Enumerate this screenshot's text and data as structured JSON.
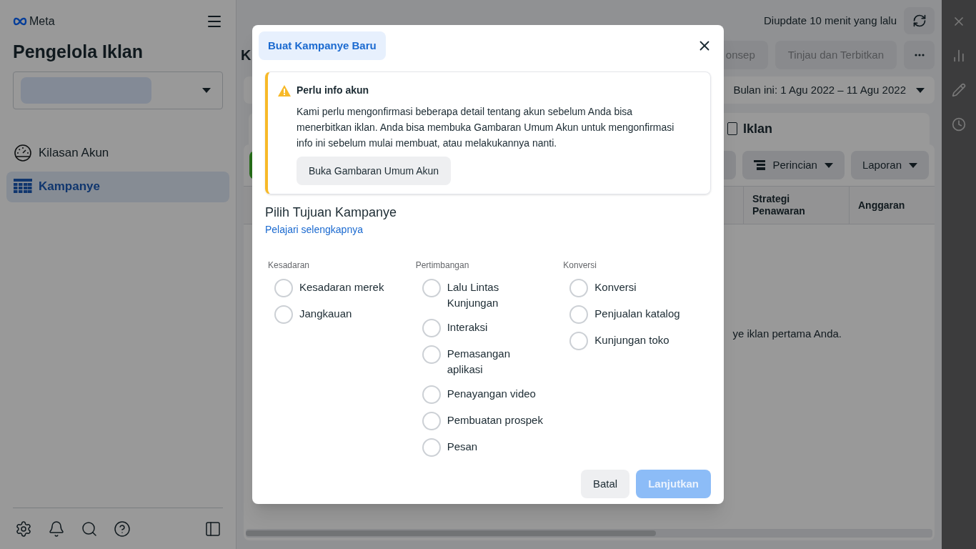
{
  "sidebar": {
    "logo": "Meta",
    "title": "Pengelola Iklan",
    "nav": [
      {
        "label": "Kilasan Akun",
        "kind": "overview",
        "selected": false
      },
      {
        "label": "Kampanye",
        "kind": "campaigns",
        "selected": true
      }
    ]
  },
  "main": {
    "updated": "Diupdate 10 menit yang lalu",
    "title_fragment": "K",
    "actions": [
      {
        "label": "onsep",
        "disabled": true
      },
      {
        "label": "Tinjau dan Terbitkan",
        "disabled": true
      }
    ],
    "date_range": "Bulan ini: 1 Agu 2022 – 11 Agu 2022",
    "tab": "Iklan",
    "toolbar": [
      {
        "label": "Perincian",
        "kind": "breakdown"
      },
      {
        "label": "Laporan",
        "kind": "plain"
      }
    ],
    "columns": [
      "Strategi Penawaran",
      "Anggaran"
    ],
    "empty_fragment": "ye iklan pertama Anda."
  },
  "modal": {
    "tab": {
      "label": "Buat Kampanye Baru",
      "selected": true
    },
    "notice": {
      "title": "Perlu info akun",
      "body": "Kami perlu mengonfirmasi beberapa detail tentang akun sebelum Anda bisa menerbitkan iklan. Anda bisa membuka Gambaran Umum Akun untuk mengonfirmasi info ini sebelum mulai membuat, atau melakukannya nanti.",
      "button": "Buka Gambaran Umum Akun"
    },
    "heading": "Pilih Tujuan Kampanye",
    "link": "Pelajari selengkapnya",
    "groups": [
      {
        "title": "Kesadaran",
        "options": [
          {
            "label": "Kesadaran merek",
            "selected": false
          },
          {
            "label": "Jangkauan",
            "selected": false
          }
        ]
      },
      {
        "title": "Pertimbangan",
        "options": [
          {
            "label": "Lalu Lintas Kunjungan",
            "selected": false
          },
          {
            "label": "Interaksi",
            "selected": false
          },
          {
            "label": "Pemasangan aplikasi",
            "selected": false
          },
          {
            "label": "Penayangan video",
            "selected": false
          },
          {
            "label": "Pembuatan prospek",
            "selected": false
          },
          {
            "label": "Pesan",
            "selected": false
          }
        ]
      },
      {
        "title": "Konversi",
        "options": [
          {
            "label": "Konversi",
            "selected": false
          },
          {
            "label": "Penjualan katalog",
            "selected": false
          },
          {
            "label": "Kunjungan toko",
            "selected": false
          }
        ]
      }
    ],
    "buttons": [
      {
        "label": "Batal",
        "kind": "secondary",
        "disabled": false
      },
      {
        "label": "Lanjutkan",
        "kind": "primary",
        "disabled": true
      }
    ]
  }
}
